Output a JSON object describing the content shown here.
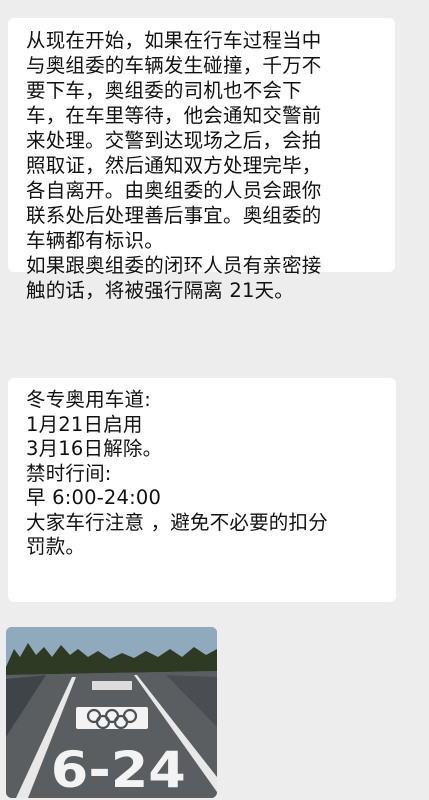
{
  "messages": [
    {
      "lines": [
        "从现在开始，如果在行车过程当中",
        "与奥组委的车辆发生碰撞，千万不",
        "要下车，奥组委的司机也不会下",
        "车，在车里等待，他会通知交警前",
        "来处理。交警到达现场之后，会拍",
        "照取证，然后通知双方处理完毕，",
        "各自离开。由奥组委的人员会跟你",
        "联系处后处理善后事宜。奥组委的",
        "车辆都有标识。",
        "如果跟奥组委的闭环人员有亲密接",
        "触的话，将被强行隔离 21天。"
      ]
    },
    {
      "lines": [
        "冬专奥用车道:",
        "1月21日启用",
        "3月16日解除。",
        "禁时行间:",
        "早 6:00-24:00",
        "大家车行注意 ，避免不必要的扣分",
        "罚款。"
      ]
    }
  ],
  "image_message": {
    "road_marking_text": "6-24",
    "emblem": "olympic-rings",
    "colors": {
      "sky": "#8fa9bd",
      "trees": "#2f3a25",
      "asphalt": "#5b5e60",
      "marking": "#f3f3f3"
    }
  },
  "colors": {
    "background": "#ededed",
    "bubble": "#ffffff",
    "text": "#111111"
  }
}
